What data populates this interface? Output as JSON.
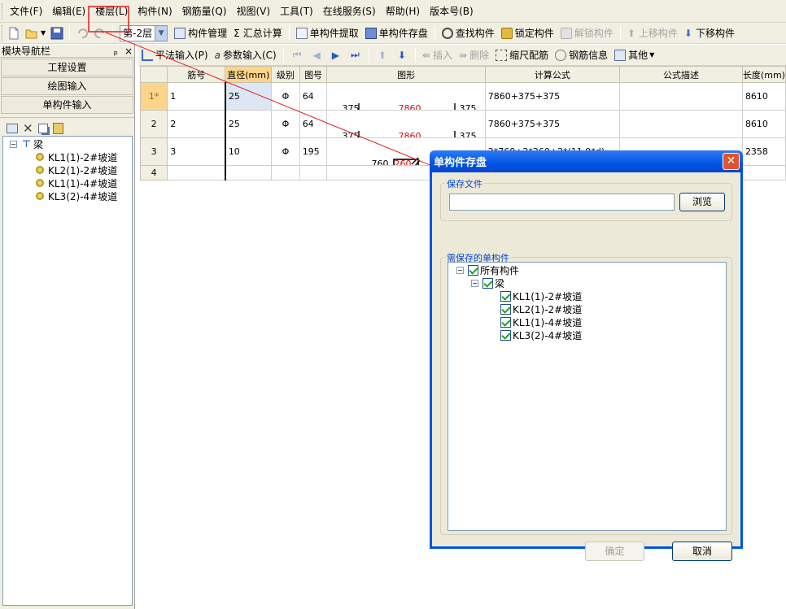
{
  "menu": [
    "文件(F)",
    "编辑(E)",
    "楼层(L)",
    "构件(N)",
    "钢筋量(Q)",
    "视图(V)",
    "工具(T)",
    "在线服务(S)",
    "帮助(H)",
    "版本号(B)"
  ],
  "toolbar1": {
    "floor": "第-2层",
    "buttons": {
      "component_manage": "构件管理",
      "sum_calc": "汇总计算",
      "single_extract": "单构件提取",
      "single_save": "单构件存盘",
      "find": "查找构件",
      "lock": "锁定构件",
      "unlock": "解锁构件",
      "move_up": "上移构件",
      "move_down": "下移构件"
    },
    "sigma": "Σ"
  },
  "left_panel": {
    "title": "模块导航栏",
    "pin": "ₚ",
    "close": "×",
    "nav": [
      "工程设置",
      "绘图输入",
      "单构件输入"
    ],
    "tree_root": "梁",
    "tree_items": [
      "KL1(1)-2#坡道",
      "KL2(1)-2#坡道",
      "KL1(1)-4#坡道",
      "KL3(2)-4#坡道"
    ]
  },
  "toolbar2": {
    "flat_input": "平法输入(P)",
    "param_input": "参数输入(C)",
    "insert": "插入",
    "delete": "删除",
    "scale": "缩尺配筋",
    "rebar_info": "钢筋信息",
    "other": "其他"
  },
  "grid": {
    "columns": [
      "",
      "筋号",
      "直径(mm)",
      "级别",
      "图号",
      "图形",
      "计算公式",
      "公式描述",
      "长度(mm)"
    ],
    "rows": [
      {
        "num": "1*",
        "id": "1",
        "dia": "25",
        "grade": "Φ",
        "fig": "64",
        "shape_l": "375",
        "shape_mid": "7860",
        "shape_r": "375",
        "formula": "7860+375+375",
        "desc": "",
        "len": "8610"
      },
      {
        "num": "2",
        "id": "2",
        "dia": "25",
        "grade": "Φ",
        "fig": "64",
        "shape_l": "375",
        "shape_mid": "7860",
        "shape_r": "375",
        "formula": "7860+375+375",
        "desc": "",
        "len": "8610"
      },
      {
        "num": "3",
        "id": "3",
        "dia": "10",
        "grade": "Φ",
        "fig": "195",
        "shape_l": "760",
        "shape_mid": "260",
        "shape_r": "",
        "formula": "2*760+2*260+2*(11.9*d)",
        "desc": "",
        "len": "2358"
      },
      {
        "num": "4",
        "id": "",
        "dia": "",
        "grade": "",
        "fig": "",
        "shape_l": "",
        "shape_mid": "",
        "shape_r": "",
        "formula": "",
        "desc": "",
        "len": ""
      }
    ]
  },
  "dialog": {
    "title": "单构件存盘",
    "save_file_label": "保存文件",
    "file_value": "",
    "browse": "浏览",
    "group_label": "需保存的单构件",
    "tree_all": "所有构件",
    "tree_beam": "梁",
    "tree_items": [
      "KL1(1)-2#坡道",
      "KL2(1)-2#坡道",
      "KL1(1)-4#坡道",
      "KL3(2)-4#坡道"
    ],
    "ok": "确定",
    "cancel": "取消"
  },
  "colors": {
    "highlight_box": "#e02020",
    "arrow": "#e02020",
    "dialog_title": "#0054e3",
    "active_header": "#fbd58c"
  }
}
